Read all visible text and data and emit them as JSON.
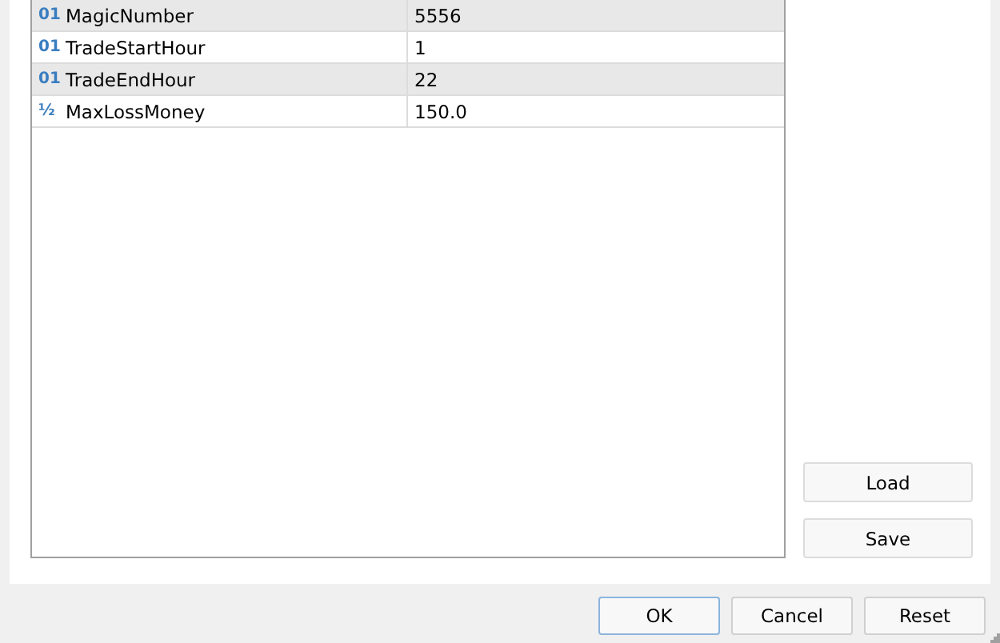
{
  "parameters": [
    {
      "type_icon": "01",
      "name": "MagicNumber",
      "value": "5556"
    },
    {
      "type_icon": "01",
      "name": "TradeStartHour",
      "value": "1"
    },
    {
      "type_icon": "01",
      "name": "TradeEndHour",
      "value": "22"
    },
    {
      "type_icon": "½",
      "name": "MaxLossMoney",
      "value": "150.0"
    }
  ],
  "side_buttons": [
    "Load",
    "Save"
  ],
  "buttons": [
    {
      "label": "OK",
      "default": true
    },
    {
      "label": "Cancel",
      "default": false
    },
    {
      "label": "Reset",
      "default": false
    }
  ]
}
